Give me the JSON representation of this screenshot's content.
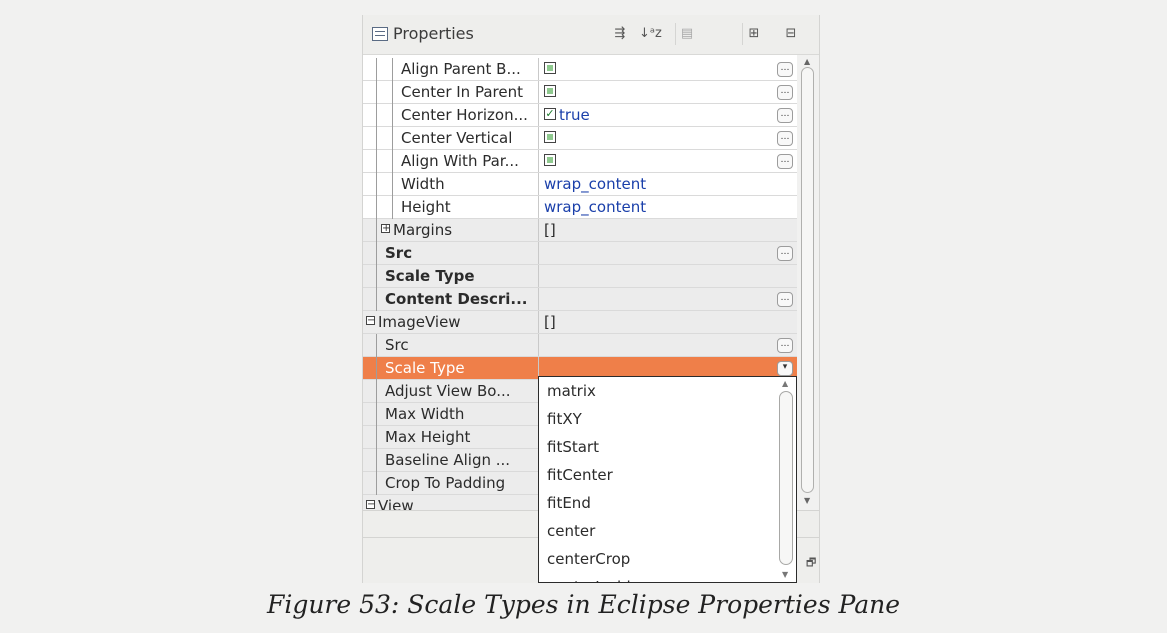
{
  "panel": {
    "title": "Properties",
    "toolbar": [
      {
        "name": "show-advanced-icon",
        "glyph": "⇶"
      },
      {
        "name": "sort-alpha-icon",
        "glyph": "↓ᵃz"
      },
      {
        "name": "restore-default-icon",
        "glyph": "▤"
      },
      {
        "name": "expand-all-icon",
        "glyph": "⊞"
      },
      {
        "name": "collapse-all-icon",
        "glyph": "⊟"
      }
    ]
  },
  "rows": [
    {
      "name": "Align Parent B...",
      "kind": "check",
      "checked": false,
      "ellipsis": true,
      "indent": 2,
      "bold": false,
      "shaded": false
    },
    {
      "name": "Center In Parent",
      "kind": "check",
      "checked": false,
      "ellipsis": true,
      "indent": 2,
      "bold": false,
      "shaded": false
    },
    {
      "name": "Center Horizon...",
      "kind": "check",
      "checked": true,
      "value": "true",
      "ellipsis": true,
      "indent": 2,
      "bold": false,
      "shaded": false
    },
    {
      "name": "Center Vertical",
      "kind": "check",
      "checked": false,
      "ellipsis": true,
      "indent": 2,
      "bold": false,
      "shaded": false
    },
    {
      "name": "Align With Par...",
      "kind": "check",
      "checked": false,
      "ellipsis": true,
      "indent": 2,
      "bold": false,
      "shaded": false
    },
    {
      "name": "Width",
      "kind": "text",
      "value": "wrap_content",
      "ellipsis": false,
      "indent": 2,
      "bold": false,
      "shaded": false
    },
    {
      "name": "Height",
      "kind": "text",
      "value": "wrap_content",
      "ellipsis": false,
      "indent": 2,
      "bold": false,
      "shaded": false
    },
    {
      "name": "Margins",
      "kind": "text",
      "value": "[]",
      "ellipsis": false,
      "indent": 1,
      "expander": "+",
      "bold": false,
      "shaded": true
    },
    {
      "name": "Src",
      "kind": "text",
      "value": "",
      "ellipsis": true,
      "indent": 1,
      "bold": true,
      "shaded": true
    },
    {
      "name": "Scale Type",
      "kind": "text",
      "value": "",
      "ellipsis": false,
      "indent": 1,
      "bold": true,
      "shaded": true
    },
    {
      "name": "Content Descri...",
      "kind": "text",
      "value": "",
      "ellipsis": true,
      "indent": 1,
      "bold": true,
      "shaded": true
    },
    {
      "name": "ImageView",
      "kind": "text",
      "value": "[]",
      "ellipsis": false,
      "indent": 0,
      "expander": "−",
      "bold": false,
      "shaded": true
    },
    {
      "name": "Src",
      "kind": "text",
      "value": "",
      "ellipsis": true,
      "indent": 1,
      "bold": false,
      "shaded": true
    },
    {
      "name": "Scale Type",
      "kind": "text",
      "value": "",
      "ellipsis": false,
      "dropdown": true,
      "indent": 1,
      "bold": false,
      "shaded": false,
      "selected": true
    },
    {
      "name": "Adjust View Bo...",
      "kind": "text",
      "value": "",
      "ellipsis": false,
      "indent": 1,
      "bold": false,
      "shaded": true
    },
    {
      "name": "Max Width",
      "kind": "text",
      "value": "",
      "ellipsis": false,
      "indent": 1,
      "bold": false,
      "shaded": true
    },
    {
      "name": "Max Height",
      "kind": "text",
      "value": "",
      "ellipsis": false,
      "indent": 1,
      "bold": false,
      "shaded": true
    },
    {
      "name": "Baseline Align ...",
      "kind": "text",
      "value": "",
      "ellipsis": false,
      "indent": 1,
      "bold": false,
      "shaded": true
    },
    {
      "name": "Crop To Padding",
      "kind": "text",
      "value": "",
      "ellipsis": false,
      "indent": 1,
      "bold": false,
      "shaded": true
    },
    {
      "name": "View",
      "kind": "text",
      "value": "",
      "ellipsis": false,
      "indent": 0,
      "expander": "−",
      "bold": false,
      "shaded": true
    }
  ],
  "dropdown": {
    "options": [
      "matrix",
      "fitXY",
      "fitStart",
      "fitCenter",
      "fitEnd",
      "center",
      "centerCrop",
      "centerInside"
    ]
  },
  "caption": "Figure 53: Scale Types in Eclipse Properties Pane",
  "colors": {
    "selection": "#ef7f49",
    "value_text": "#1a3faa"
  }
}
